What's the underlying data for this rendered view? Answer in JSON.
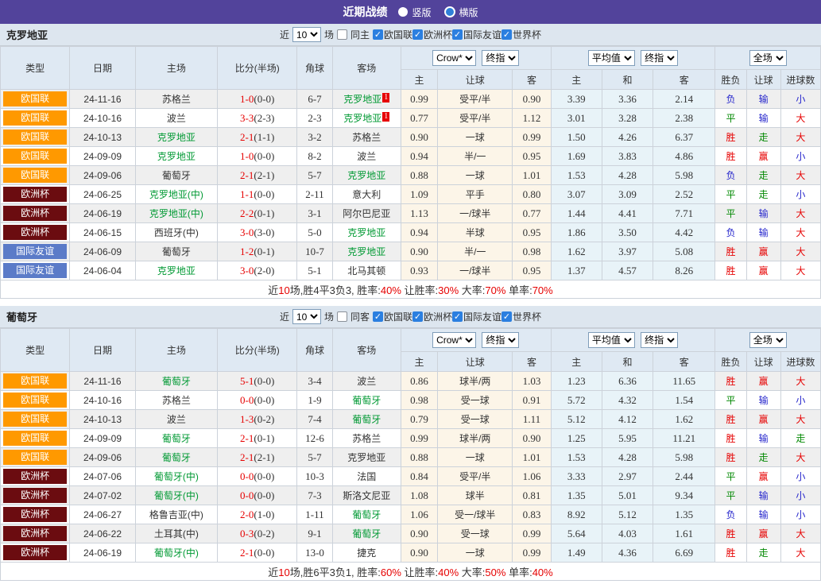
{
  "colors": {
    "topbar_bg": "#52439b",
    "league_nations": "#ff9900",
    "league_euro": "#6b0c10",
    "league_friendly": "#5b7bc8",
    "team_highlight": "#009933",
    "win_big": "#e60000",
    "draw_walk": "#008800",
    "lose_small": "#2626cc",
    "section_bar_bg": "#dde6ef",
    "header_cell_bg": "#dfe9f3",
    "odds_col_bg": "#fcf5e8",
    "avg_col_bg": "#e8f3f8"
  },
  "topbar": {
    "title": "近期战绩",
    "radio_vertical": "竖版",
    "radio_horizontal": "横版"
  },
  "filters": {
    "near": "近",
    "count": "10",
    "games": "场",
    "leagues": [
      "欧国联",
      "欧洲杯",
      "国际友谊",
      "世界杯"
    ]
  },
  "cols": {
    "type": "类型",
    "date": "日期",
    "home": "主场",
    "score": "比分(半场)",
    "corner": "角球",
    "away": "客场",
    "sel_company": "Crow*",
    "sel_final1": "终指",
    "sel_avg": "平均值",
    "sel_final2": "终指",
    "sel_fulltime": "全场",
    "h": "主",
    "handicap": "让球",
    "a": "客",
    "avg_h": "主",
    "avg_d": "和",
    "avg_a": "客",
    "wl": "胜负",
    "hc": "让球",
    "goals": "进球数"
  },
  "sections": [
    {
      "team": "克罗地亚",
      "same": "同主",
      "rows": [
        {
          "league": "欧国联",
          "lcls": "lg-nl",
          "date": "24-11-16",
          "home": "苏格兰",
          "hcls": "",
          "hsup": "",
          "score": "1-0",
          "half": "(0-0)",
          "corner": "6-7",
          "away": "克罗地亚",
          "acls": "t-hl",
          "asup": "1",
          "o1": "0.99",
          "hd": "受平/半",
          "o2": "0.90",
          "a1": "3.39",
          "a2": "3.36",
          "a3": "2.14",
          "r1": "负",
          "c1": "c-blue",
          "r2": "输",
          "c2": "c-blue",
          "r3": "小",
          "c3": "c-blue"
        },
        {
          "league": "欧国联",
          "lcls": "lg-nl",
          "date": "24-10-16",
          "home": "波兰",
          "hcls": "",
          "hsup": "",
          "score": "3-3",
          "half": "(2-3)",
          "corner": "2-3",
          "away": "克罗地亚",
          "acls": "t-hl",
          "asup": "1",
          "o1": "0.77",
          "hd": "受平/半",
          "o2": "1.12",
          "a1": "3.01",
          "a2": "3.28",
          "a3": "2.38",
          "r1": "平",
          "c1": "c-green",
          "r2": "输",
          "c2": "c-blue",
          "r3": "大",
          "c3": "c-red"
        },
        {
          "league": "欧国联",
          "lcls": "lg-nl",
          "date": "24-10-13",
          "home": "克罗地亚",
          "hcls": "t-hl",
          "hsup": "",
          "score": "2-1",
          "half": "(1-1)",
          "corner": "3-2",
          "away": "苏格兰",
          "acls": "",
          "asup": "",
          "o1": "0.90",
          "hd": "一球",
          "o2": "0.99",
          "a1": "1.50",
          "a2": "4.26",
          "a3": "6.37",
          "r1": "胜",
          "c1": "c-red",
          "r2": "走",
          "c2": "c-green",
          "r3": "大",
          "c3": "c-red"
        },
        {
          "league": "欧国联",
          "lcls": "lg-nl",
          "date": "24-09-09",
          "home": "克罗地亚",
          "hcls": "t-hl",
          "hsup": "",
          "score": "1-0",
          "half": "(0-0)",
          "corner": "8-2",
          "away": "波兰",
          "acls": "",
          "asup": "",
          "o1": "0.94",
          "hd": "半/一",
          "o2": "0.95",
          "a1": "1.69",
          "a2": "3.83",
          "a3": "4.86",
          "r1": "胜",
          "c1": "c-red",
          "r2": "赢",
          "c2": "c-red",
          "r3": "小",
          "c3": "c-blue"
        },
        {
          "league": "欧国联",
          "lcls": "lg-nl",
          "date": "24-09-06",
          "home": "葡萄牙",
          "hcls": "",
          "hsup": "",
          "score": "2-1",
          "half": "(2-1)",
          "corner": "5-7",
          "away": "克罗地亚",
          "acls": "t-hl",
          "asup": "",
          "o1": "0.88",
          "hd": "一球",
          "o2": "1.01",
          "a1": "1.53",
          "a2": "4.28",
          "a3": "5.98",
          "r1": "负",
          "c1": "c-blue",
          "r2": "走",
          "c2": "c-green",
          "r3": "大",
          "c3": "c-red"
        },
        {
          "league": "欧洲杯",
          "lcls": "lg-euro",
          "date": "24-06-25",
          "home": "克罗地亚(中)",
          "hcls": "t-hl",
          "hsup": "",
          "score": "1-1",
          "half": "(0-0)",
          "corner": "2-11",
          "away": "意大利",
          "acls": "",
          "asup": "",
          "o1": "1.09",
          "hd": "平手",
          "o2": "0.80",
          "a1": "3.07",
          "a2": "3.09",
          "a3": "2.52",
          "r1": "平",
          "c1": "c-green",
          "r2": "走",
          "c2": "c-green",
          "r3": "小",
          "c3": "c-blue"
        },
        {
          "league": "欧洲杯",
          "lcls": "lg-euro",
          "date": "24-06-19",
          "home": "克罗地亚(中)",
          "hcls": "t-hl",
          "hsup": "",
          "score": "2-2",
          "half": "(0-1)",
          "corner": "3-1",
          "away": "阿尔巴尼亚",
          "acls": "",
          "asup": "",
          "o1": "1.13",
          "hd": "一/球半",
          "o2": "0.77",
          "a1": "1.44",
          "a2": "4.41",
          "a3": "7.71",
          "r1": "平",
          "c1": "c-green",
          "r2": "输",
          "c2": "c-blue",
          "r3": "大",
          "c3": "c-red"
        },
        {
          "league": "欧洲杯",
          "lcls": "lg-euro",
          "date": "24-06-15",
          "home": "西班牙(中)",
          "hcls": "",
          "hsup": "",
          "score": "3-0",
          "half": "(3-0)",
          "corner": "5-0",
          "away": "克罗地亚",
          "acls": "t-hl",
          "asup": "",
          "o1": "0.94",
          "hd": "半球",
          "o2": "0.95",
          "a1": "1.86",
          "a2": "3.50",
          "a3": "4.42",
          "r1": "负",
          "c1": "c-blue",
          "r2": "输",
          "c2": "c-blue",
          "r3": "大",
          "c3": "c-red"
        },
        {
          "league": "国际友谊",
          "lcls": "lg-fr",
          "date": "24-06-09",
          "home": "葡萄牙",
          "hcls": "",
          "hsup": "",
          "score": "1-2",
          "half": "(0-1)",
          "corner": "10-7",
          "away": "克罗地亚",
          "acls": "t-hl",
          "asup": "",
          "o1": "0.90",
          "hd": "半/一",
          "o2": "0.98",
          "a1": "1.62",
          "a2": "3.97",
          "a3": "5.08",
          "r1": "胜",
          "c1": "c-red",
          "r2": "赢",
          "c2": "c-red",
          "r3": "大",
          "c3": "c-red"
        },
        {
          "league": "国际友谊",
          "lcls": "lg-fr",
          "date": "24-06-04",
          "home": "克罗地亚",
          "hcls": "t-hl",
          "hsup": "",
          "score": "3-0",
          "half": "(2-0)",
          "corner": "5-1",
          "away": "北马其顿",
          "acls": "",
          "asup": "",
          "o1": "0.93",
          "hd": "一/球半",
          "o2": "0.95",
          "a1": "1.37",
          "a2": "4.57",
          "a3": "8.26",
          "r1": "胜",
          "c1": "c-red",
          "r2": "赢",
          "c2": "c-red",
          "r3": "大",
          "c3": "c-red"
        }
      ],
      "summary": [
        {
          "text": "近",
          "cls": "sum-d"
        },
        {
          "text": "10",
          "cls": "sum-r"
        },
        {
          "text": "场,胜4平3负3, 胜率:",
          "cls": "sum-d"
        },
        {
          "text": "40%",
          "cls": "sum-r"
        },
        {
          "text": " 让胜率:",
          "cls": "sum-d"
        },
        {
          "text": "30%",
          "cls": "sum-r"
        },
        {
          "text": " 大率:",
          "cls": "sum-d"
        },
        {
          "text": "70%",
          "cls": "sum-r"
        },
        {
          "text": " 单率:",
          "cls": "sum-d"
        },
        {
          "text": "70%",
          "cls": "sum-r"
        }
      ]
    },
    {
      "team": "葡萄牙",
      "same": "同客",
      "rows": [
        {
          "league": "欧国联",
          "lcls": "lg-nl",
          "date": "24-11-16",
          "home": "葡萄牙",
          "hcls": "t-hl",
          "hsup": "",
          "score": "5-1",
          "half": "(0-0)",
          "corner": "3-4",
          "away": "波兰",
          "acls": "",
          "asup": "",
          "o1": "0.86",
          "hd": "球半/两",
          "o2": "1.03",
          "a1": "1.23",
          "a2": "6.36",
          "a3": "11.65",
          "r1": "胜",
          "c1": "c-red",
          "r2": "赢",
          "c2": "c-red",
          "r3": "大",
          "c3": "c-red"
        },
        {
          "league": "欧国联",
          "lcls": "lg-nl",
          "date": "24-10-16",
          "home": "苏格兰",
          "hcls": "",
          "hsup": "",
          "score": "0-0",
          "half": "(0-0)",
          "corner": "1-9",
          "away": "葡萄牙",
          "acls": "t-hl",
          "asup": "",
          "o1": "0.98",
          "hd": "受一球",
          "o2": "0.91",
          "a1": "5.72",
          "a2": "4.32",
          "a3": "1.54",
          "r1": "平",
          "c1": "c-green",
          "r2": "输",
          "c2": "c-blue",
          "r3": "小",
          "c3": "c-blue"
        },
        {
          "league": "欧国联",
          "lcls": "lg-nl",
          "date": "24-10-13",
          "home": "波兰",
          "hcls": "",
          "hsup": "",
          "score": "1-3",
          "half": "(0-2)",
          "corner": "7-4",
          "away": "葡萄牙",
          "acls": "t-hl",
          "asup": "",
          "o1": "0.79",
          "hd": "受一球",
          "o2": "1.11",
          "a1": "5.12",
          "a2": "4.12",
          "a3": "1.62",
          "r1": "胜",
          "c1": "c-red",
          "r2": "赢",
          "c2": "c-red",
          "r3": "大",
          "c3": "c-red"
        },
        {
          "league": "欧国联",
          "lcls": "lg-nl",
          "date": "24-09-09",
          "home": "葡萄牙",
          "hcls": "t-hl",
          "hsup": "",
          "score": "2-1",
          "half": "(0-1)",
          "corner": "12-6",
          "away": "苏格兰",
          "acls": "",
          "asup": "",
          "o1": "0.99",
          "hd": "球半/两",
          "o2": "0.90",
          "a1": "1.25",
          "a2": "5.95",
          "a3": "11.21",
          "r1": "胜",
          "c1": "c-red",
          "r2": "输",
          "c2": "c-blue",
          "r3": "走",
          "c3": "c-green"
        },
        {
          "league": "欧国联",
          "lcls": "lg-nl",
          "date": "24-09-06",
          "home": "葡萄牙",
          "hcls": "t-hl",
          "hsup": "",
          "score": "2-1",
          "half": "(2-1)",
          "corner": "5-7",
          "away": "克罗地亚",
          "acls": "",
          "asup": "",
          "o1": "0.88",
          "hd": "一球",
          "o2": "1.01",
          "a1": "1.53",
          "a2": "4.28",
          "a3": "5.98",
          "r1": "胜",
          "c1": "c-red",
          "r2": "走",
          "c2": "c-green",
          "r3": "大",
          "c3": "c-red"
        },
        {
          "league": "欧洲杯",
          "lcls": "lg-euro",
          "date": "24-07-06",
          "home": "葡萄牙(中)",
          "hcls": "t-hl",
          "hsup": "",
          "score": "0-0",
          "half": "(0-0)",
          "corner": "10-3",
          "away": "法国",
          "acls": "",
          "asup": "",
          "o1": "0.84",
          "hd": "受平/半",
          "o2": "1.06",
          "a1": "3.33",
          "a2": "2.97",
          "a3": "2.44",
          "r1": "平",
          "c1": "c-green",
          "r2": "赢",
          "c2": "c-red",
          "r3": "小",
          "c3": "c-blue"
        },
        {
          "league": "欧洲杯",
          "lcls": "lg-euro",
          "date": "24-07-02",
          "home": "葡萄牙(中)",
          "hcls": "t-hl",
          "hsup": "",
          "score": "0-0",
          "half": "(0-0)",
          "corner": "7-3",
          "away": "斯洛文尼亚",
          "acls": "",
          "asup": "",
          "o1": "1.08",
          "hd": "球半",
          "o2": "0.81",
          "a1": "1.35",
          "a2": "5.01",
          "a3": "9.34",
          "r1": "平",
          "c1": "c-green",
          "r2": "输",
          "c2": "c-blue",
          "r3": "小",
          "c3": "c-blue"
        },
        {
          "league": "欧洲杯",
          "lcls": "lg-euro",
          "date": "24-06-27",
          "home": "格鲁吉亚(中)",
          "hcls": "",
          "hsup": "",
          "score": "2-0",
          "half": "(1-0)",
          "corner": "1-11",
          "away": "葡萄牙",
          "acls": "t-hl",
          "asup": "",
          "o1": "1.06",
          "hd": "受一/球半",
          "o2": "0.83",
          "a1": "8.92",
          "a2": "5.12",
          "a3": "1.35",
          "r1": "负",
          "c1": "c-blue",
          "r2": "输",
          "c2": "c-blue",
          "r3": "小",
          "c3": "c-blue"
        },
        {
          "league": "欧洲杯",
          "lcls": "lg-euro",
          "date": "24-06-22",
          "home": "土耳其(中)",
          "hcls": "",
          "hsup": "",
          "score": "0-3",
          "half": "(0-2)",
          "corner": "9-1",
          "away": "葡萄牙",
          "acls": "t-hl",
          "asup": "",
          "o1": "0.90",
          "hd": "受一球",
          "o2": "0.99",
          "a1": "5.64",
          "a2": "4.03",
          "a3": "1.61",
          "r1": "胜",
          "c1": "c-red",
          "r2": "赢",
          "c2": "c-red",
          "r3": "大",
          "c3": "c-red"
        },
        {
          "league": "欧洲杯",
          "lcls": "lg-euro",
          "date": "24-06-19",
          "home": "葡萄牙(中)",
          "hcls": "t-hl",
          "hsup": "",
          "score": "2-1",
          "half": "(0-0)",
          "corner": "13-0",
          "away": "捷克",
          "acls": "",
          "asup": "",
          "o1": "0.90",
          "hd": "一球",
          "o2": "0.99",
          "a1": "1.49",
          "a2": "4.36",
          "a3": "6.69",
          "r1": "胜",
          "c1": "c-red",
          "r2": "走",
          "c2": "c-green",
          "r3": "大",
          "c3": "c-red"
        }
      ],
      "summary": [
        {
          "text": "近",
          "cls": "sum-d"
        },
        {
          "text": "10",
          "cls": "sum-r"
        },
        {
          "text": "场,胜6平3负1, 胜率:",
          "cls": "sum-d"
        },
        {
          "text": "60%",
          "cls": "sum-r"
        },
        {
          "text": " 让胜率:",
          "cls": "sum-d"
        },
        {
          "text": "40%",
          "cls": "sum-r"
        },
        {
          "text": " 大率:",
          "cls": "sum-d"
        },
        {
          "text": "50%",
          "cls": "sum-r"
        },
        {
          "text": " 单率:",
          "cls": "sum-d"
        },
        {
          "text": "40%",
          "cls": "sum-r"
        }
      ]
    }
  ]
}
